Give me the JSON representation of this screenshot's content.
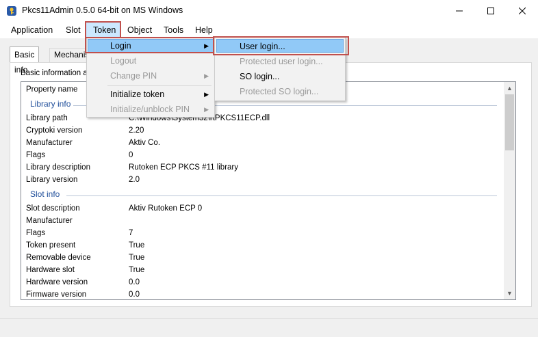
{
  "window": {
    "title": "Pkcs11Admin 0.5.0 64-bit on MS Windows",
    "minimize_glyph": "—",
    "maximize_glyph": "☐",
    "close_glyph": "✕"
  },
  "menubar": {
    "items": [
      "Application",
      "Slot",
      "Token",
      "Object",
      "Tools",
      "Help"
    ]
  },
  "tabs": [
    "Basic info",
    "Mechanis"
  ],
  "group_label": "Basic information abo",
  "list": {
    "header_property": "Property name",
    "library_section": "Library info",
    "library_rows": [
      {
        "k": "Library path",
        "v": "C:\\Windows\\System32\\rtPKCS11ECP.dll"
      },
      {
        "k": "Cryptoki version",
        "v": "2.20"
      },
      {
        "k": "Manufacturer",
        "v": "Aktiv Co."
      },
      {
        "k": "Flags",
        "v": "0"
      },
      {
        "k": "Library description",
        "v": "Rutoken ECP PKCS #11 library"
      },
      {
        "k": "Library version",
        "v": "2.0"
      }
    ],
    "slot_section": "Slot info",
    "slot_rows": [
      {
        "k": "Slot description",
        "v": "Aktiv Rutoken ECP 0"
      },
      {
        "k": "Manufacturer",
        "v": ""
      },
      {
        "k": "Flags",
        "v": "7"
      },
      {
        "k": "Token present",
        "v": "True"
      },
      {
        "k": "Removable device",
        "v": "True"
      },
      {
        "k": "Hardware slot",
        "v": "True"
      },
      {
        "k": "Hardware version",
        "v": "0.0"
      },
      {
        "k": "Firmware version",
        "v": "0.0"
      }
    ]
  },
  "token_menu": {
    "items": [
      {
        "label": "Login",
        "disabled": false,
        "submenu": true
      },
      {
        "label": "Logout",
        "disabled": true,
        "submenu": false
      },
      {
        "label": "Change PIN",
        "disabled": true,
        "submenu": true
      },
      {
        "label": "Initialize token",
        "disabled": false,
        "submenu": true
      },
      {
        "label": "Initialize/unblock PIN",
        "disabled": true,
        "submenu": true
      }
    ]
  },
  "login_submenu": {
    "items": [
      {
        "label": "User login...",
        "disabled": false
      },
      {
        "label": "Protected user login...",
        "disabled": true
      },
      {
        "label": "SO login...",
        "disabled": false
      },
      {
        "label": "Protected SO login...",
        "disabled": true
      }
    ]
  },
  "colors": {
    "highlight": "#91c9f7",
    "annotation_red": "#c0504d",
    "section_blue": "#1f4e9a"
  },
  "icons": {
    "app": "key-icon",
    "submenu_arrow": "▶",
    "scroll_up": "▲",
    "scroll_down": "▼"
  }
}
